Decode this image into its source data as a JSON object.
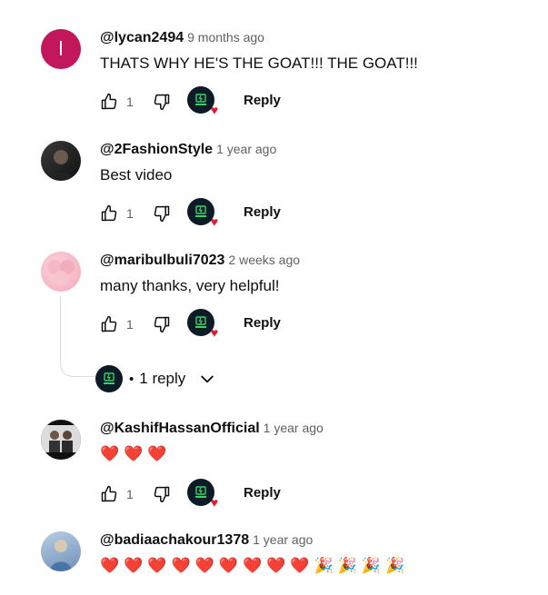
{
  "colors": {
    "accent_heart": "#e5192d",
    "author_text": "#0f0f0f",
    "meta_text": "#606060",
    "avatar_red": "#c2185b"
  },
  "comments": [
    {
      "avatar_letter": "l",
      "author": "@lycan2494",
      "time": "9 months ago",
      "text": "THATS WHY HE'S THE GOAT!!! THE GOAT!!!",
      "likes": "1",
      "reply_label": "Reply"
    },
    {
      "author": "@2FashionStyle",
      "time": "1 year ago",
      "text": "Best video",
      "likes": "1",
      "reply_label": "Reply"
    },
    {
      "author": "@maribulbuli7023",
      "time": "2 weeks ago",
      "text": "many thanks, very helpful!",
      "likes": "1",
      "reply_label": "Reply",
      "replies_label": "1 reply",
      "replies_dot": "•"
    },
    {
      "author": "@KashifHassanOfficial",
      "time": "1 year ago",
      "text": "❤️❤️❤️",
      "likes": "1",
      "reply_label": "Reply"
    },
    {
      "author": "@badiaachakour1378",
      "time": "1 year ago",
      "text_hearts": "❤️❤️❤️❤️❤️❤️❤️❤️❤️",
      "text_party": "🎉🎉🎉🎉"
    }
  ]
}
